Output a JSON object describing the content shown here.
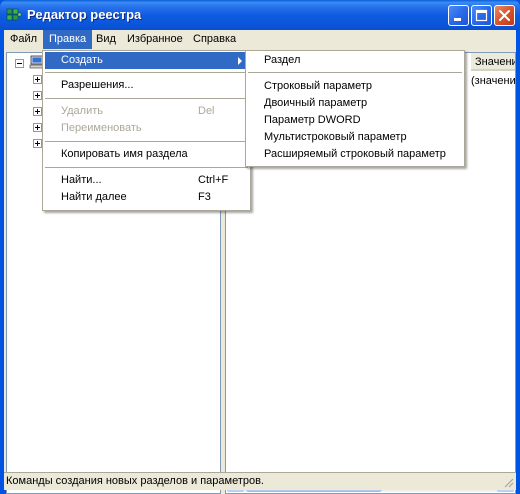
{
  "window": {
    "title": "Редактор реестра"
  },
  "menubar": {
    "file": "Файл",
    "edit": "Правка",
    "view": "Вид",
    "favorites": "Избранное",
    "help": "Справка"
  },
  "list": {
    "col_value": "Значение",
    "row_value": "(значение"
  },
  "edit_menu": {
    "create": "Создать",
    "permissions": "Разрешения...",
    "delete": "Удалить",
    "delete_shortcut": "Del",
    "rename": "Переименовать",
    "copy_key_name": "Копировать имя раздела",
    "find": "Найти...",
    "find_shortcut": "Ctrl+F",
    "find_next": "Найти далее",
    "find_next_shortcut": "F3"
  },
  "create_submenu": {
    "key": "Раздел",
    "string_value": "Строковый параметр",
    "binary_value": "Двоичный параметр",
    "dword_value": "Параметр DWORD",
    "multistring_value": "Мультистроковый параметр",
    "expandable_string_value": "Расширяемый строковый параметр"
  },
  "statusbar": {
    "text": "Команды создания новых разделов и параметров."
  },
  "colors": {
    "titlebar": "#0a56dc",
    "menu_highlight": "#316ac5",
    "disabled_text": "#aca899",
    "window_bg": "#ece9d8"
  }
}
